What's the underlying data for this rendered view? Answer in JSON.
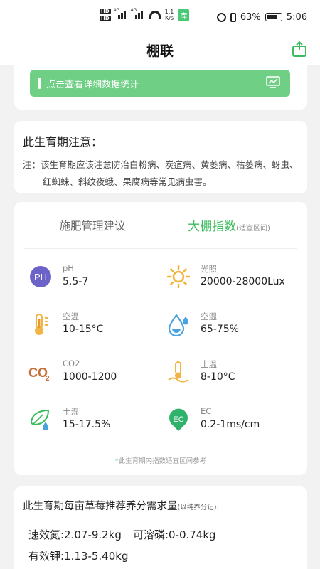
{
  "status_bar": {
    "hd1": "HD",
    "hd2": "HD",
    "net1": "4G",
    "net2": "4G",
    "speed_value": "1.1",
    "speed_unit": "K/s",
    "lib_badge": "库",
    "battery_percent": "63%",
    "time": "5:06"
  },
  "header": {
    "title": "棚联",
    "share_icon": "share-icon"
  },
  "stats_button": {
    "label": "点击查看详细数据统计",
    "icon": "chart-monitor-icon"
  },
  "notice": {
    "title": "此生育期注意：",
    "text": "注：该生育期应该注意防治白粉病、炭疽病、黄萎病、枯萎病、蚜虫、红蜘蛛、斜纹夜蛾、果腐病等常见病虫害。"
  },
  "tabs": {
    "fertilizer": "施肥管理建议",
    "greenhouse": "大棚指数",
    "greenhouse_sub": "(适宜区间)"
  },
  "indices": [
    {
      "icon": "ph-icon",
      "label": "pH",
      "value": "5.5-7"
    },
    {
      "icon": "sun-icon",
      "label": "光照",
      "value": "20000-28000Lux"
    },
    {
      "icon": "thermometer-icon",
      "label": "空温",
      "value": "10-15°C"
    },
    {
      "icon": "water-drop-icon",
      "label": "空湿",
      "value": "65-75%"
    },
    {
      "icon": "co2-icon",
      "label": "CO2",
      "value": "1000-1200"
    },
    {
      "icon": "soil-temperature-icon",
      "label": "土温",
      "value": "8-10°C"
    },
    {
      "icon": "leaf-moisture-icon",
      "label": "土湿",
      "value": "15-17.5%"
    },
    {
      "icon": "ec-icon",
      "label": "EC",
      "value": "0.2-1ms/cm"
    }
  ],
  "ph_badge": "PH",
  "co2_text": "CO",
  "co2_sub": "2",
  "ec_badge": "EC",
  "footnote": {
    "star": "*",
    "text": "此生育期内指数适宜区间参考"
  },
  "nutrient": {
    "title": "此生育期每亩草莓推荐养分需求量",
    "title_note": "(以纯养分记):",
    "nitrogen": "速效氮:2.07-9.2kg",
    "phosphorus": "可溶磷:0-0.74kg",
    "potassium": "有效钾:1.13-5.40kg"
  },
  "colors": {
    "accent_green": "#3dbb5f",
    "button_green": "#6ecf85",
    "ph_purple": "#6c63c9",
    "sun_orange": "#f5b335",
    "drop_blue": "#4aa3df",
    "co2_brown": "#c4703a"
  }
}
